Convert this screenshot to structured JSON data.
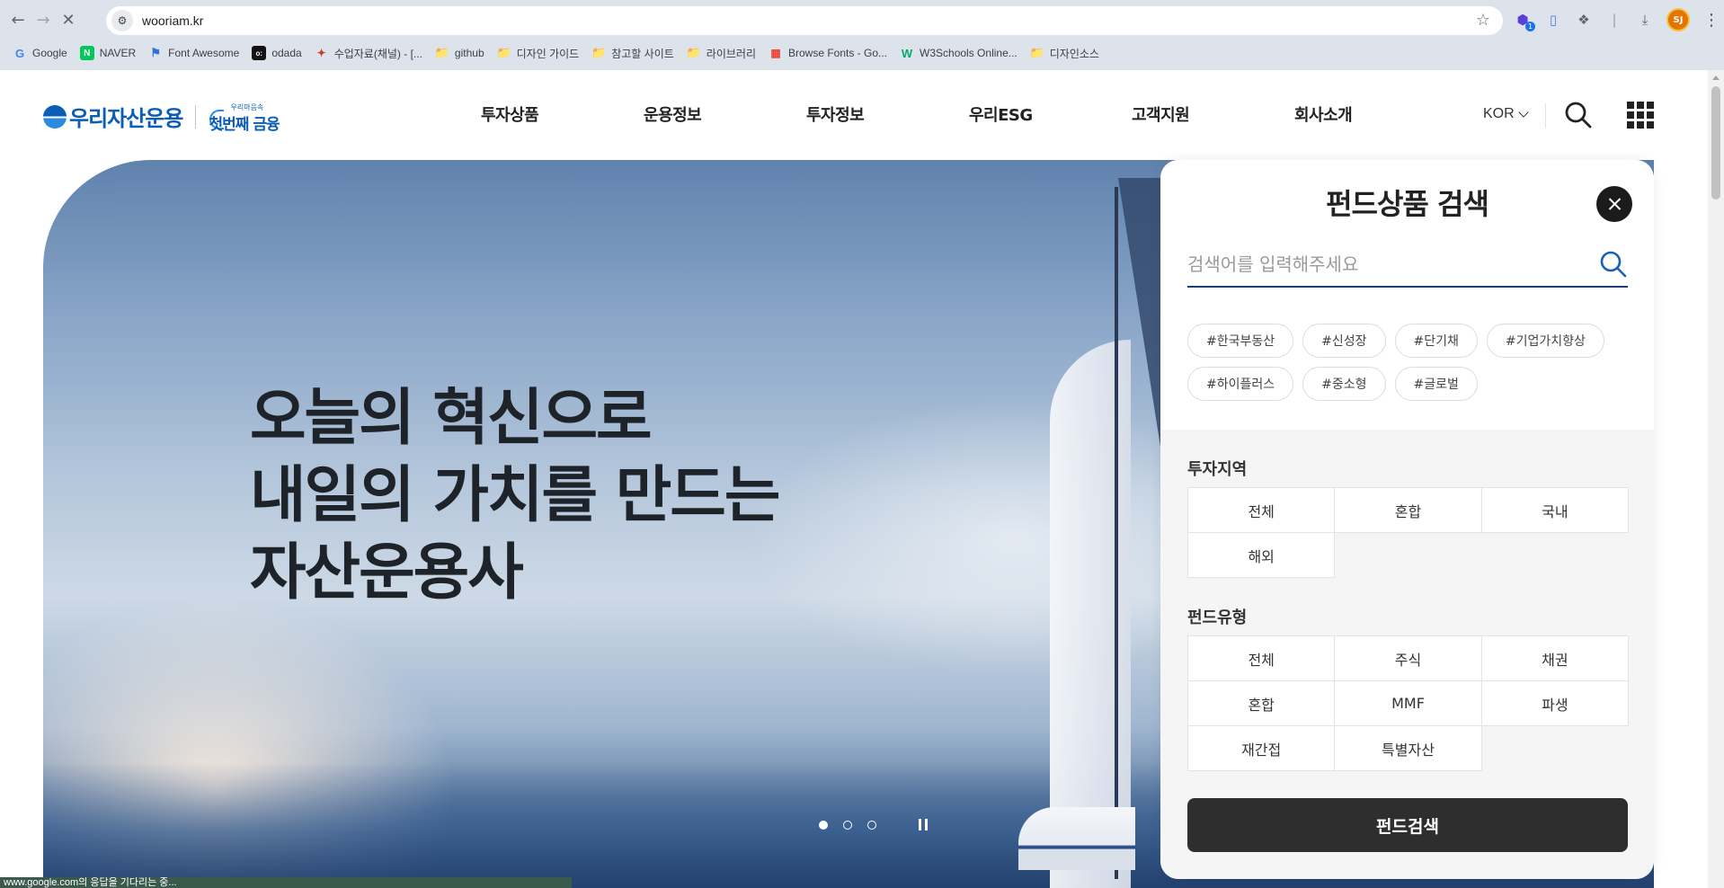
{
  "browser": {
    "url": "wooriam.kr",
    "bookmarks": [
      "Google",
      "NAVER",
      "Font Awesome",
      "odada",
      "수업자료(채널) - [...",
      "github",
      "디자인 가이드",
      "참고할 사이트",
      "라이브러리",
      "Browse Fonts - Go...",
      "W3Schools Online...",
      "디자인소스"
    ],
    "profile_initials": "SJ",
    "status_text": "www.google.com의 응답을 기다리는 중..."
  },
  "site": {
    "logo_text": "우리자산운용",
    "logo_sub_small": "우리마음속",
    "logo_sub_big": "첫번째 금융",
    "nav": [
      "투자상품",
      "운용정보",
      "투자정보",
      "우리ESG",
      "고객지원",
      "회사소개"
    ],
    "lang": "KOR"
  },
  "hero": {
    "line1": "오늘의 혁신으로",
    "line2": "내일의 가치를 만드는",
    "line3": "자산운용사",
    "slide_count": 3,
    "active_slide": 1
  },
  "search_panel": {
    "title": "펀드상품 검색",
    "placeholder": "검색어를 입력해주세요",
    "tags": [
      "#한국부동산",
      "#신성장",
      "#단기채",
      "#기업가치향상",
      "#하이플러스",
      "#중소형",
      "#글로벌"
    ],
    "region_title": "투자지역",
    "regions": [
      "전체",
      "혼합",
      "국내",
      "해외"
    ],
    "type_title": "펀드유형",
    "types": [
      "전체",
      "주식",
      "채권",
      "혼합",
      "MMF",
      "파생",
      "재간접",
      "특별자산"
    ],
    "submit_label": "펀드검색"
  },
  "colors": {
    "brand_blue": "#0b5db5",
    "search_underline": "#1b3e7a",
    "submit_bg": "#2e2e2e"
  }
}
